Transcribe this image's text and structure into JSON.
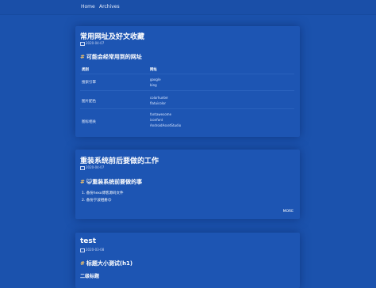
{
  "nav": {
    "home": "Home",
    "archives": "Archives"
  },
  "post1": {
    "title": "常用网址及好文收藏",
    "date": "2020-04-07",
    "heading_hash": "#",
    "heading": "可能会经常用到的网址",
    "table": {
      "headers": [
        "类别",
        "网址"
      ],
      "rows": [
        {
          "category": "搜索引擎",
          "links": [
            "google",
            "bing"
          ]
        },
        {
          "category": "图片配色",
          "links": [
            "colorhunter",
            "flatuicolor"
          ]
        },
        {
          "category": "图标相关",
          "links": [
            "fontawesome",
            "iconfont",
            "AndroidAssetStudio"
          ]
        }
      ]
    }
  },
  "post2": {
    "title": "重装系统前后要做的工作",
    "date": "2020-04-07",
    "heading_hash": "#",
    "heading": "😺重装系统前要做的事",
    "list": [
      "备份hexo博客源码文件",
      "备份宁波相册😊"
    ],
    "more": "MORE"
  },
  "post3": {
    "title": "test",
    "date": "2020-03-08",
    "heading_hash": "#",
    "heading": "标题大小测试(h1)",
    "subheading": "二级标题"
  }
}
